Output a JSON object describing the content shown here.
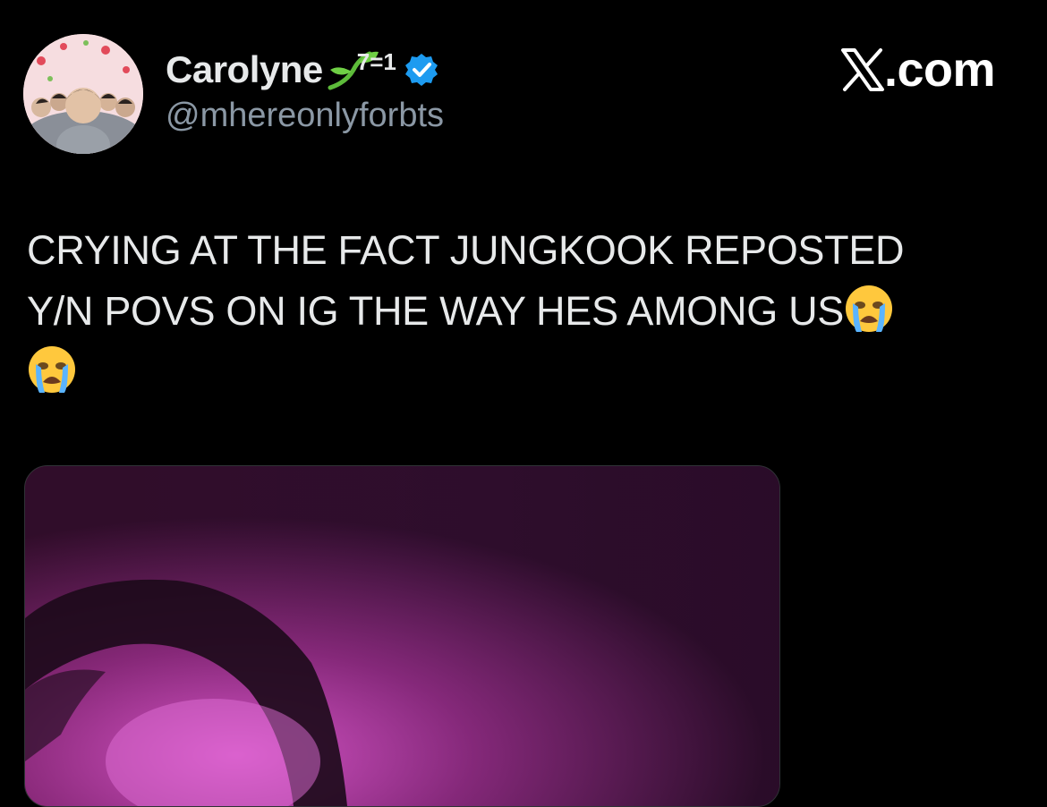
{
  "author": {
    "display_name": "Carolyne",
    "name_suffix": "7=1",
    "handle": "@mhereonlyforbts",
    "avatar_icon": "avatar-photo",
    "sprout_icon": "seedling-emoji",
    "verified_icon": "verified-badge",
    "verified_color": "#1d9bf0"
  },
  "brand": {
    "logo_icon": "x-logo",
    "text": ".com"
  },
  "tweet": {
    "line1": "CRYING AT THE FACT JUNGKOOK REPOSTED",
    "line2": "Y/N POVS ON IG THE WAY HES AMONG US",
    "emoji_icon": "loudly-crying-face-emoji"
  },
  "media": {
    "type": "video-thumbnail",
    "dominant_color": "#c23fa8"
  },
  "colors": {
    "background": "#000000",
    "text_primary": "#e7e9ea",
    "text_secondary": "#8b98a5"
  }
}
